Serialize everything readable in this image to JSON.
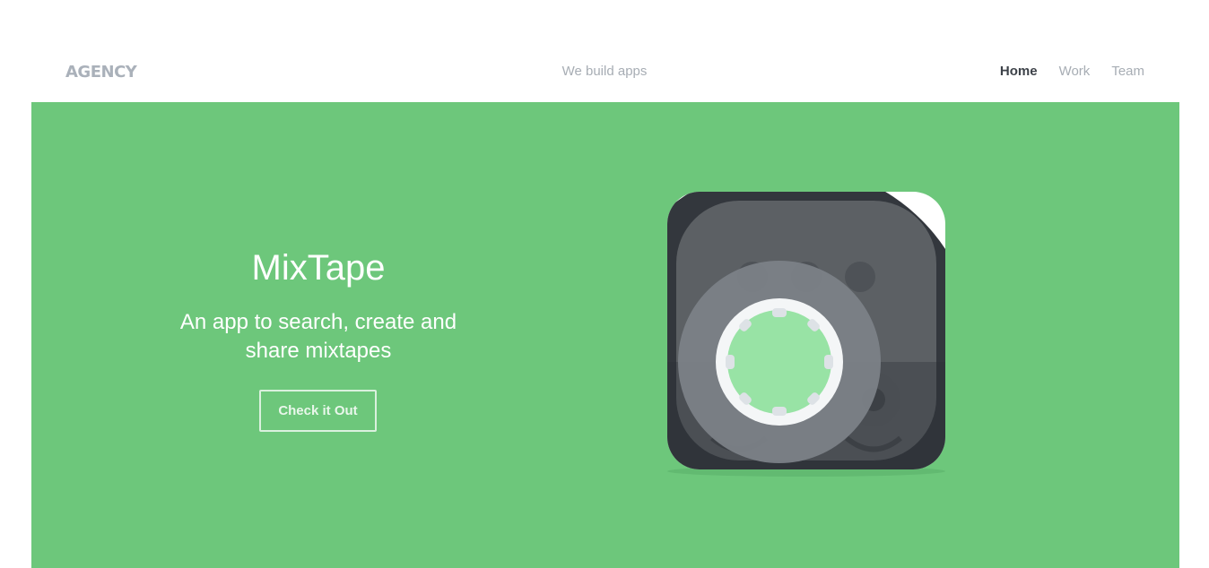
{
  "header": {
    "logo": "AGENCY",
    "tagline": "We build apps",
    "nav": [
      {
        "label": "Home"
      },
      {
        "label": "Work"
      },
      {
        "label": "Team"
      }
    ]
  },
  "hero": {
    "title": "MixTape",
    "description": "An app to search, create and share mixtapes",
    "cta_label": "Check it Out",
    "background_color": "#6dc77b",
    "app_icon": "mixtape-app-icon"
  },
  "colors": {
    "nav_active": "#3d4249",
    "nav_inactive": "#a7adb4",
    "logo": "#aab1ba"
  }
}
